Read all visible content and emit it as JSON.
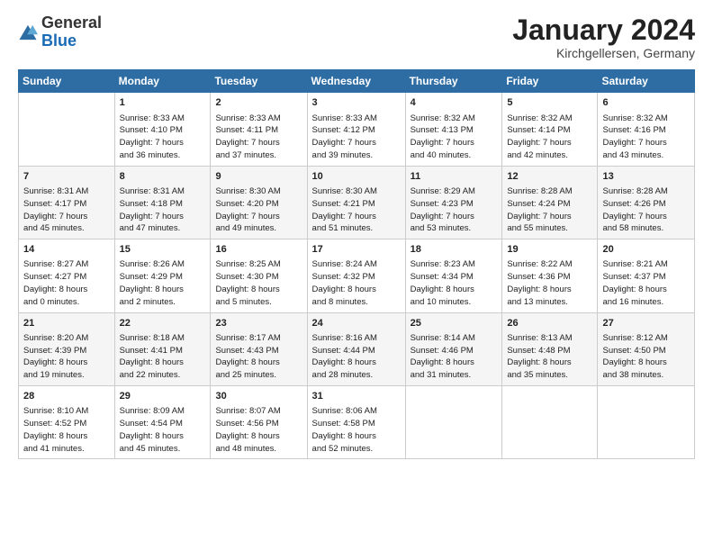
{
  "logo": {
    "general": "General",
    "blue": "Blue"
  },
  "header": {
    "month": "January 2024",
    "location": "Kirchgellersen, Germany"
  },
  "columns": [
    "Sunday",
    "Monday",
    "Tuesday",
    "Wednesday",
    "Thursday",
    "Friday",
    "Saturday"
  ],
  "weeks": [
    [
      {
        "day": "",
        "content": ""
      },
      {
        "day": "1",
        "content": "Sunrise: 8:33 AM\nSunset: 4:10 PM\nDaylight: 7 hours\nand 36 minutes."
      },
      {
        "day": "2",
        "content": "Sunrise: 8:33 AM\nSunset: 4:11 PM\nDaylight: 7 hours\nand 37 minutes."
      },
      {
        "day": "3",
        "content": "Sunrise: 8:33 AM\nSunset: 4:12 PM\nDaylight: 7 hours\nand 39 minutes."
      },
      {
        "day": "4",
        "content": "Sunrise: 8:32 AM\nSunset: 4:13 PM\nDaylight: 7 hours\nand 40 minutes."
      },
      {
        "day": "5",
        "content": "Sunrise: 8:32 AM\nSunset: 4:14 PM\nDaylight: 7 hours\nand 42 minutes."
      },
      {
        "day": "6",
        "content": "Sunrise: 8:32 AM\nSunset: 4:16 PM\nDaylight: 7 hours\nand 43 minutes."
      }
    ],
    [
      {
        "day": "7",
        "content": "Sunrise: 8:31 AM\nSunset: 4:17 PM\nDaylight: 7 hours\nand 45 minutes."
      },
      {
        "day": "8",
        "content": "Sunrise: 8:31 AM\nSunset: 4:18 PM\nDaylight: 7 hours\nand 47 minutes."
      },
      {
        "day": "9",
        "content": "Sunrise: 8:30 AM\nSunset: 4:20 PM\nDaylight: 7 hours\nand 49 minutes."
      },
      {
        "day": "10",
        "content": "Sunrise: 8:30 AM\nSunset: 4:21 PM\nDaylight: 7 hours\nand 51 minutes."
      },
      {
        "day": "11",
        "content": "Sunrise: 8:29 AM\nSunset: 4:23 PM\nDaylight: 7 hours\nand 53 minutes."
      },
      {
        "day": "12",
        "content": "Sunrise: 8:28 AM\nSunset: 4:24 PM\nDaylight: 7 hours\nand 55 minutes."
      },
      {
        "day": "13",
        "content": "Sunrise: 8:28 AM\nSunset: 4:26 PM\nDaylight: 7 hours\nand 58 minutes."
      }
    ],
    [
      {
        "day": "14",
        "content": "Sunrise: 8:27 AM\nSunset: 4:27 PM\nDaylight: 8 hours\nand 0 minutes."
      },
      {
        "day": "15",
        "content": "Sunrise: 8:26 AM\nSunset: 4:29 PM\nDaylight: 8 hours\nand 2 minutes."
      },
      {
        "day": "16",
        "content": "Sunrise: 8:25 AM\nSunset: 4:30 PM\nDaylight: 8 hours\nand 5 minutes."
      },
      {
        "day": "17",
        "content": "Sunrise: 8:24 AM\nSunset: 4:32 PM\nDaylight: 8 hours\nand 8 minutes."
      },
      {
        "day": "18",
        "content": "Sunrise: 8:23 AM\nSunset: 4:34 PM\nDaylight: 8 hours\nand 10 minutes."
      },
      {
        "day": "19",
        "content": "Sunrise: 8:22 AM\nSunset: 4:36 PM\nDaylight: 8 hours\nand 13 minutes."
      },
      {
        "day": "20",
        "content": "Sunrise: 8:21 AM\nSunset: 4:37 PM\nDaylight: 8 hours\nand 16 minutes."
      }
    ],
    [
      {
        "day": "21",
        "content": "Sunrise: 8:20 AM\nSunset: 4:39 PM\nDaylight: 8 hours\nand 19 minutes."
      },
      {
        "day": "22",
        "content": "Sunrise: 8:18 AM\nSunset: 4:41 PM\nDaylight: 8 hours\nand 22 minutes."
      },
      {
        "day": "23",
        "content": "Sunrise: 8:17 AM\nSunset: 4:43 PM\nDaylight: 8 hours\nand 25 minutes."
      },
      {
        "day": "24",
        "content": "Sunrise: 8:16 AM\nSunset: 4:44 PM\nDaylight: 8 hours\nand 28 minutes."
      },
      {
        "day": "25",
        "content": "Sunrise: 8:14 AM\nSunset: 4:46 PM\nDaylight: 8 hours\nand 31 minutes."
      },
      {
        "day": "26",
        "content": "Sunrise: 8:13 AM\nSunset: 4:48 PM\nDaylight: 8 hours\nand 35 minutes."
      },
      {
        "day": "27",
        "content": "Sunrise: 8:12 AM\nSunset: 4:50 PM\nDaylight: 8 hours\nand 38 minutes."
      }
    ],
    [
      {
        "day": "28",
        "content": "Sunrise: 8:10 AM\nSunset: 4:52 PM\nDaylight: 8 hours\nand 41 minutes."
      },
      {
        "day": "29",
        "content": "Sunrise: 8:09 AM\nSunset: 4:54 PM\nDaylight: 8 hours\nand 45 minutes."
      },
      {
        "day": "30",
        "content": "Sunrise: 8:07 AM\nSunset: 4:56 PM\nDaylight: 8 hours\nand 48 minutes."
      },
      {
        "day": "31",
        "content": "Sunrise: 8:06 AM\nSunset: 4:58 PM\nDaylight: 8 hours\nand 52 minutes."
      },
      {
        "day": "",
        "content": ""
      },
      {
        "day": "",
        "content": ""
      },
      {
        "day": "",
        "content": ""
      }
    ]
  ]
}
